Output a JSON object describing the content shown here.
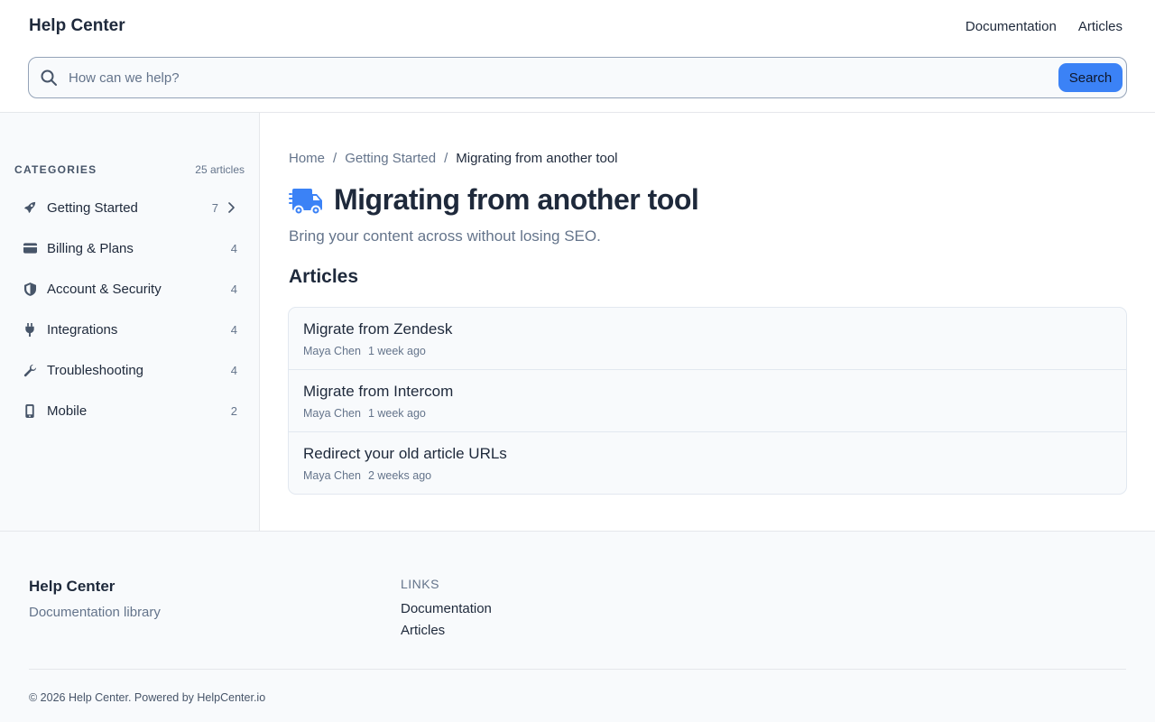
{
  "header": {
    "brand": "Help Center",
    "nav": [
      "Documentation",
      "Articles"
    ]
  },
  "search": {
    "placeholder": "How can we help?",
    "value": "",
    "button_label": "Search"
  },
  "sidebar": {
    "title": "CATEGORIES",
    "total": "25 articles",
    "items": [
      {
        "icon": "rocket-icon",
        "label": "Getting Started",
        "count": "7",
        "active": true
      },
      {
        "icon": "credit-card-icon",
        "label": "Billing & Plans",
        "count": "4"
      },
      {
        "icon": "shield-icon",
        "label": "Account & Security",
        "count": "4"
      },
      {
        "icon": "plug-icon",
        "label": "Integrations",
        "count": "4"
      },
      {
        "icon": "wrench-icon",
        "label": "Troubleshooting",
        "count": "4"
      },
      {
        "icon": "phone-icon",
        "label": "Mobile",
        "count": "2"
      }
    ]
  },
  "main": {
    "breadcrumb": [
      "Home",
      "Getting Started",
      "Migrating from another tool"
    ],
    "breadcrumb_separator": "/",
    "title_icon": "truck-icon",
    "title": "Migrating from another tool",
    "subtitle": "Bring your content across without losing SEO.",
    "section_title": "Articles",
    "articles": [
      {
        "title": "Migrate from Zendesk",
        "author": "Maya Chen",
        "time": "1 week ago"
      },
      {
        "title": "Migrate from Intercom",
        "author": "Maya Chen",
        "time": "1 week ago"
      },
      {
        "title": "Redirect your old article URLs",
        "author": "Maya Chen",
        "time": "2 weeks ago"
      }
    ]
  },
  "footer": {
    "brand": "Help Center",
    "tagline": "Documentation library",
    "links_title": "LINKS",
    "links": [
      "Documentation",
      "Articles"
    ],
    "copyright": "© 2026 Help Center. Powered by HelpCenter.io"
  },
  "colors": {
    "accent": "#3b82f6",
    "text": "#1e293b",
    "muted": "#64748b",
    "surface": "#f8fafc",
    "border": "#e5e7eb"
  }
}
